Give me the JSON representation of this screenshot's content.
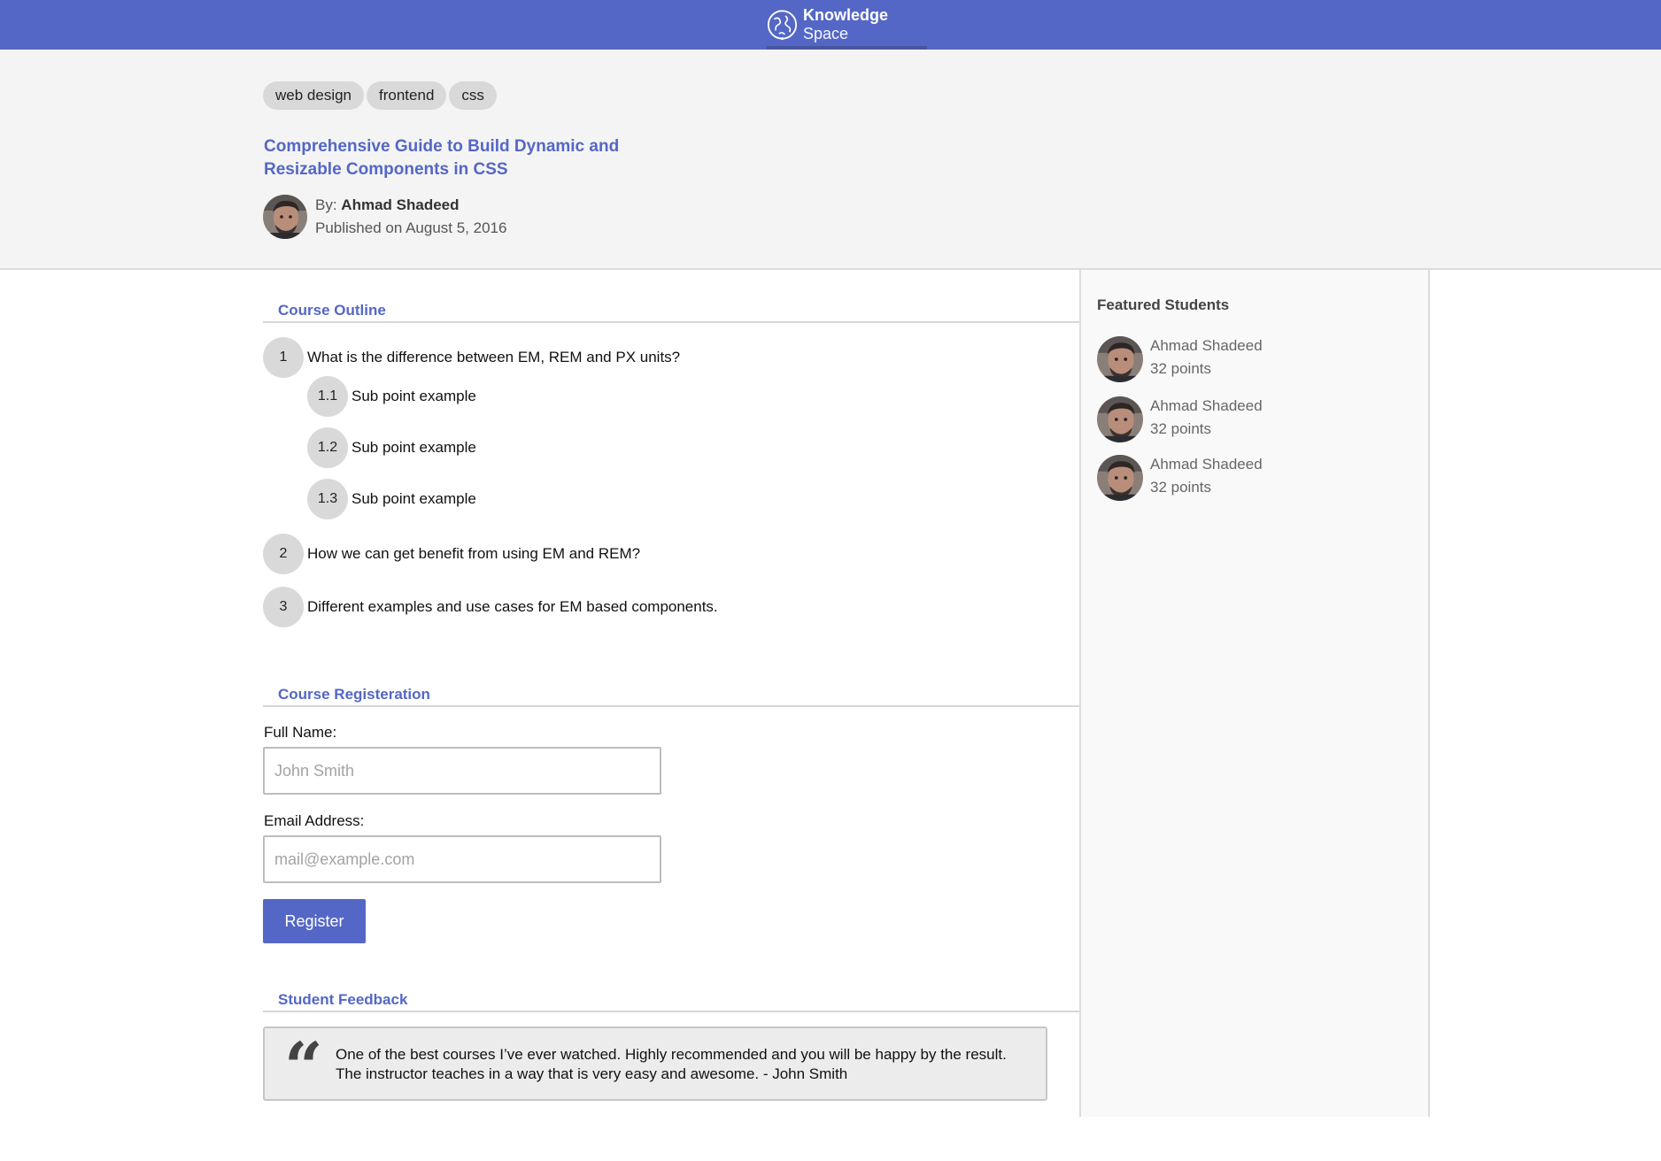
{
  "header": {
    "brand_bold": "Knowledge",
    "brand_light": "Space",
    "accent_color": "#5467c6"
  },
  "course": {
    "tags": [
      "web design",
      "frontend",
      "css"
    ],
    "title": "Comprehensive Guide to Build Dynamic and Resizable Components in CSS",
    "by_label": "By:",
    "author": "Ahmad Shadeed",
    "published": "Published on August 5, 2016"
  },
  "outline": {
    "heading": "Course Outline",
    "items": [
      {
        "num": "1",
        "text": "What is the difference between EM, REM and PX units?"
      },
      {
        "num": "1.1",
        "text": "Sub point example"
      },
      {
        "num": "1.2",
        "text": "Sub point example"
      },
      {
        "num": "1.3",
        "text": "Sub point example"
      },
      {
        "num": "2",
        "text": "How we can get benefit from using EM and REM?"
      },
      {
        "num": "3",
        "text": "Different examples and use cases for EM based components."
      }
    ]
  },
  "registration": {
    "heading": "Course Registeration",
    "name_label": "Full Name:",
    "name_placeholder": "John Smith",
    "email_label": "Email Address:",
    "email_placeholder": "mail@example.com",
    "button": "Register"
  },
  "feedback": {
    "heading": "Student Feedback",
    "quote_mark": "“",
    "text": "One of the best courses I’ve ever watched. Highly recommended and you will be happy by the result. The instructor teaches in a way that is very easy and awesome. - John Smith"
  },
  "sidebar": {
    "title": "Featured Students",
    "students": [
      {
        "name": "Ahmad Shadeed",
        "points": "32 points"
      },
      {
        "name": "Ahmad Shadeed",
        "points": "32 points"
      },
      {
        "name": "Ahmad Shadeed",
        "points": "32 points"
      }
    ]
  }
}
